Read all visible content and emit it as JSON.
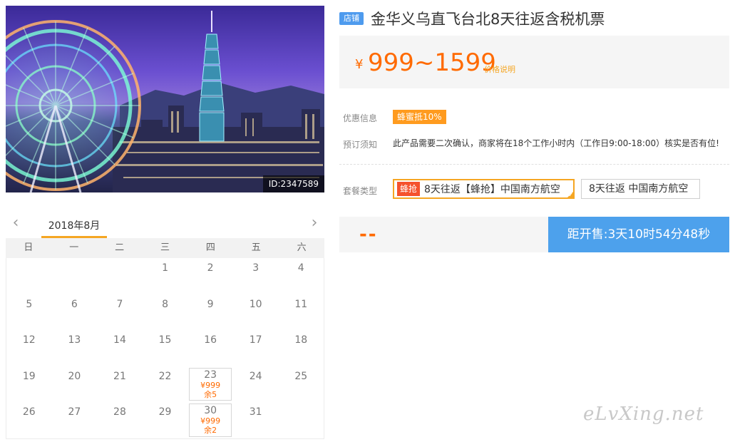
{
  "hero": {
    "id_label": "ID:2347589"
  },
  "calendar": {
    "month_label": "2018年8月",
    "prev_icon": "chevron-left-icon",
    "next_icon": "chevron-right-icon",
    "weekdays": [
      "日",
      "一",
      "二",
      "三",
      "四",
      "五",
      "六"
    ],
    "rows": [
      [
        {
          "d": ""
        },
        {
          "d": ""
        },
        {
          "d": ""
        },
        {
          "d": "1"
        },
        {
          "d": "2"
        },
        {
          "d": "3"
        },
        {
          "d": "4"
        }
      ],
      [
        {
          "d": "5"
        },
        {
          "d": "6"
        },
        {
          "d": "7"
        },
        {
          "d": "8"
        },
        {
          "d": "9"
        },
        {
          "d": "10"
        },
        {
          "d": "11"
        }
      ],
      [
        {
          "d": "12"
        },
        {
          "d": "13"
        },
        {
          "d": "14"
        },
        {
          "d": "15"
        },
        {
          "d": "16"
        },
        {
          "d": "17"
        },
        {
          "d": "18"
        }
      ],
      [
        {
          "d": "19"
        },
        {
          "d": "20"
        },
        {
          "d": "21"
        },
        {
          "d": "22"
        },
        {
          "d": "23",
          "price": "¥999",
          "left": "余5"
        },
        {
          "d": "24"
        },
        {
          "d": "25"
        }
      ],
      [
        {
          "d": "26"
        },
        {
          "d": "27"
        },
        {
          "d": "28"
        },
        {
          "d": "29"
        },
        {
          "d": "30",
          "price": "¥999",
          "left": "余2"
        },
        {
          "d": "31"
        },
        {
          "d": ""
        }
      ]
    ]
  },
  "product": {
    "shop_badge": "店铺",
    "title": "金华义乌直飞台北8天往返含税机票",
    "price_currency": "¥",
    "price_range": "999~1599",
    "price_note_link": "价格说明",
    "promo_label": "优惠信息",
    "promo_tag": "蜂蜜抵10%",
    "notice_label": "预订须知",
    "notice_text": "此产品需要二次确认，商家将在18个工作小时内（工作日9:00-18:00）核实是否有位!",
    "package_label": "套餐类型",
    "packages": [
      {
        "flash_tag": "蜂抢",
        "label": "8天往返【蜂抢】中国南方航空"
      },
      {
        "label": "8天往返 中国南方航空"
      }
    ],
    "buy_placeholder": "--",
    "countdown": "距开售:3天10时54分48秒"
  },
  "watermark": "eLvXing.net",
  "colors": {
    "accent": "#ff6a00",
    "badge_blue": "#4e9bee",
    "countdown_blue": "#4da1ec",
    "tab_orange": "#f5a623"
  }
}
